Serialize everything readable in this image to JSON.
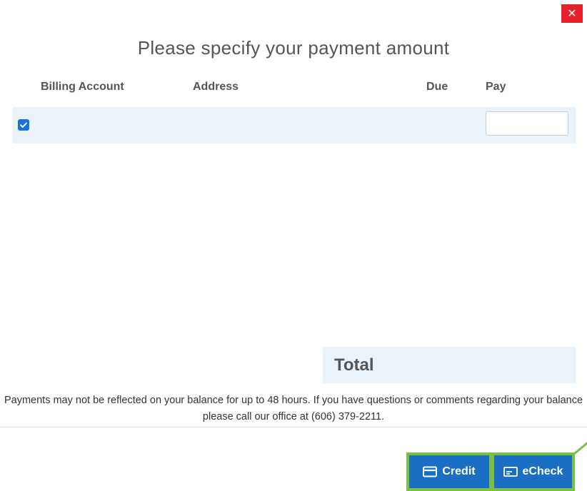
{
  "dialog": {
    "close_label": "✕",
    "title": "Please specify your payment amount"
  },
  "table": {
    "headers": {
      "billing_account": "Billing Account",
      "address": "Address",
      "due": "Due",
      "pay": "Pay"
    },
    "rows": [
      {
        "checked": true,
        "billing_account": "",
        "address": "",
        "due": "",
        "pay_value": ""
      }
    ]
  },
  "total": {
    "label": "Total"
  },
  "note": "Payments may not be reflected on your balance for up to 48 hours. If you have questions or comments regarding your balance please call our office at (606) 379-2211.",
  "buttons": {
    "credit_label": "Credit",
    "credit_icon": "credit-card-icon",
    "echeck_label": "eCheck",
    "echeck_icon": "check-icon"
  },
  "colors": {
    "close": "#e8202a",
    "button": "#1a6fc4",
    "highlight": "#7ac143",
    "row_bg": "#eaf2fa",
    "checkbox": "#1a73d9"
  }
}
